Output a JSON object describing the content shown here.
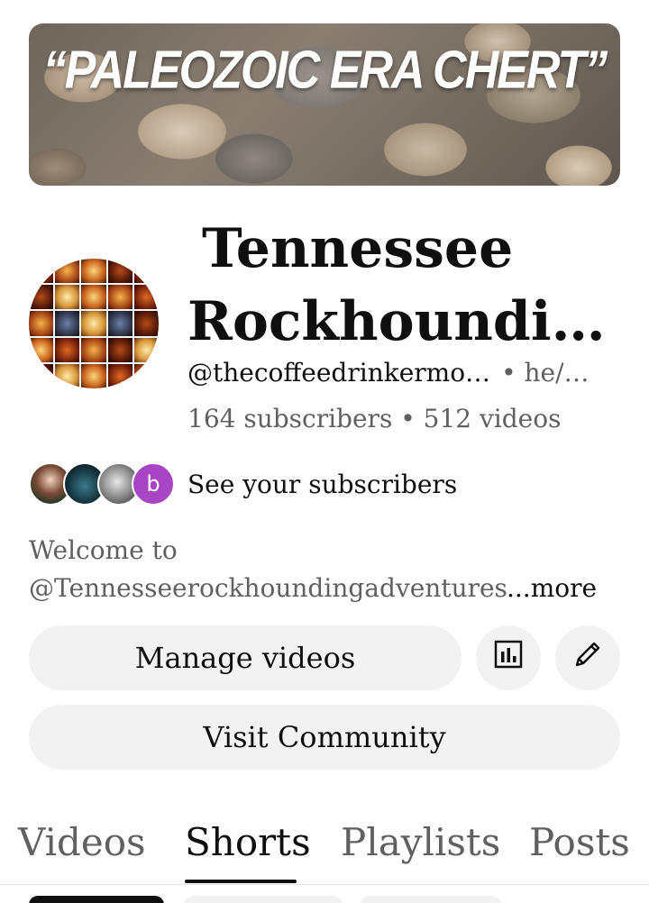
{
  "banner": {
    "text": "“PALEOZOIC ERA CHERT”"
  },
  "channel": {
    "name_line1": "Tennessee",
    "name_line2": "Rockhoundin…",
    "handle": "@thecoffeedrinkermo…",
    "pronouns": "• he/…",
    "stats": "164 subscribers • 512 videos"
  },
  "subscribers": {
    "see_label": "See your subscribers",
    "letter_avatar": "b"
  },
  "description": {
    "line1": "Welcome to",
    "line2": "@Tennesseerockhoundingadventures",
    "more": "...more"
  },
  "buttons": {
    "manage": "Manage videos",
    "community": "Visit Community"
  },
  "icons": {
    "analytics": "bar-chart-icon",
    "edit": "pencil-icon"
  },
  "tabs": [
    {
      "label": "Videos"
    },
    {
      "label": "Shorts",
      "selected": true
    },
    {
      "label": "Playlists"
    },
    {
      "label": "Posts"
    }
  ]
}
